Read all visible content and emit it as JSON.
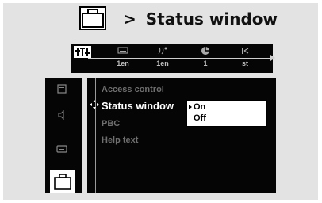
{
  "header": {
    "icon": "briefcase-icon",
    "arrow": ">",
    "title": "Status window"
  },
  "topbar": {
    "tabs": [
      {
        "icon": "settings-icon",
        "value": ""
      },
      {
        "icon": "subtitle-icon",
        "value": "1en"
      },
      {
        "icon": "audio-language-icon",
        "value": "1en"
      },
      {
        "icon": "angle-icon",
        "value": "1"
      },
      {
        "icon": "audio-output-icon",
        "value": "st"
      }
    ]
  },
  "sidebar": {
    "items": [
      {
        "icon": "disc-menu-icon"
      },
      {
        "icon": "speaker-icon"
      },
      {
        "icon": "display-icon"
      },
      {
        "icon": "briefcase-icon"
      }
    ]
  },
  "menu": {
    "items": [
      {
        "label": "Access control"
      },
      {
        "label": "Status window"
      },
      {
        "label": "PBC"
      },
      {
        "label": "Help text"
      }
    ],
    "selected_index": 1
  },
  "submenu": {
    "options": [
      "On",
      "Off"
    ],
    "selected": "On"
  },
  "colors": {
    "background": "#e3e3e3",
    "panel": "#050505",
    "highlight": "#ffffff",
    "dim_text": "#6f6f6f"
  }
}
